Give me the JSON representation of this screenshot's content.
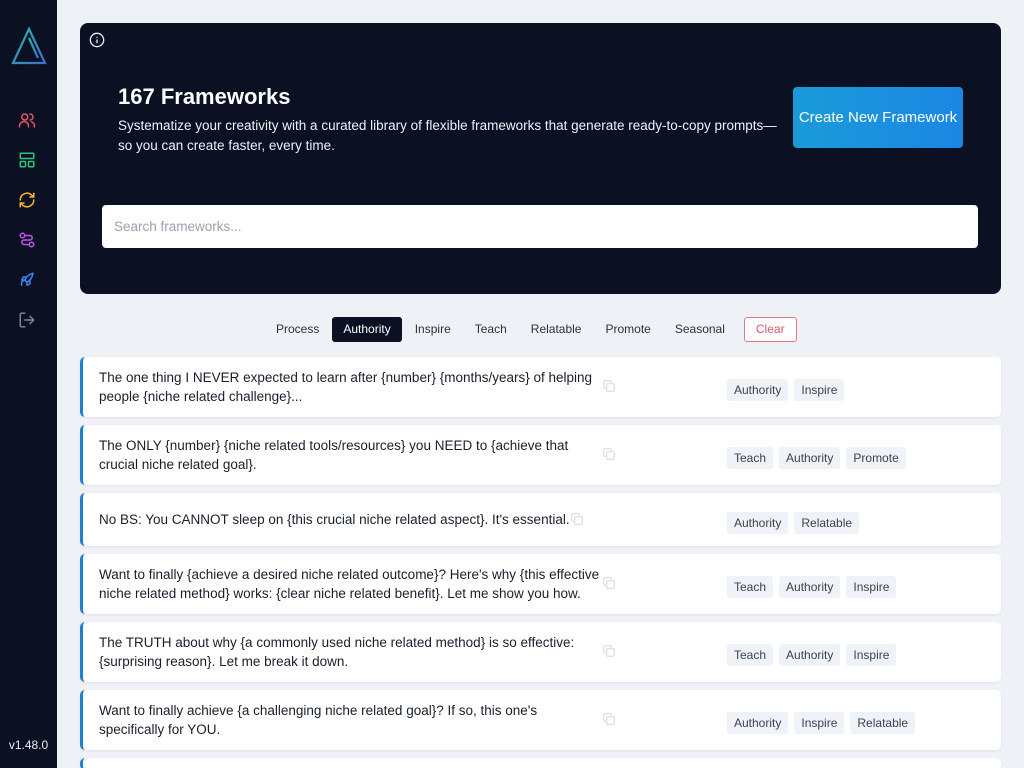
{
  "sidebar": {
    "items": [
      {
        "name": "users",
        "icon": "users-icon",
        "color": "#e8546b"
      },
      {
        "name": "layout",
        "icon": "layout-icon",
        "color": "#2fc47a"
      },
      {
        "name": "refresh",
        "icon": "refresh-icon",
        "color": "#f5b82e"
      },
      {
        "name": "workflow",
        "icon": "workflow-icon",
        "color": "#c44ef0"
      },
      {
        "name": "rocket",
        "icon": "rocket-icon",
        "color": "#3b86f0"
      },
      {
        "name": "logout",
        "icon": "logout-icon",
        "color": "#7d8596"
      }
    ],
    "version": "v1.48.0"
  },
  "hero": {
    "title": "167 Frameworks",
    "subtitle": "Systematize your creativity with a curated library of flexible frameworks that generate ready-to-copy prompts—so you can create faster, every time.",
    "create_button": "Create New Framework",
    "search_placeholder": "Search frameworks..."
  },
  "filters": {
    "items": [
      "Process",
      "Authority",
      "Inspire",
      "Teach",
      "Relatable",
      "Promote",
      "Seasonal"
    ],
    "active": "Authority",
    "clear_label": "Clear"
  },
  "cards": [
    {
      "text": "The one thing I NEVER expected to learn after {number} {months/years} of helping people {niche related challenge}...",
      "tags": [
        "Authority",
        "Inspire"
      ]
    },
    {
      "text": "The ONLY {number} {niche related tools/resources} you NEED to {achieve that crucial niche related goal}.",
      "tags": [
        "Teach",
        "Authority",
        "Promote"
      ]
    },
    {
      "text": "No BS: You CANNOT sleep on {this crucial niche related aspect}. It's essential.",
      "tags": [
        "Authority",
        "Relatable"
      ]
    },
    {
      "text": "Want to finally {achieve a desired niche related outcome}? Here's why {this effective niche related method} works: {clear niche related benefit}. Let me show you how.",
      "tags": [
        "Teach",
        "Authority",
        "Inspire"
      ]
    },
    {
      "text": "The TRUTH about why {a commonly used niche related method} is so effective: {surprising reason}. Let me break it down.",
      "tags": [
        "Teach",
        "Authority",
        "Inspire"
      ]
    },
    {
      "text": "Want to finally achieve {a challenging niche related goal}? If so, this one's specifically for YOU.",
      "tags": [
        "Authority",
        "Inspire",
        "Relatable"
      ]
    }
  ]
}
